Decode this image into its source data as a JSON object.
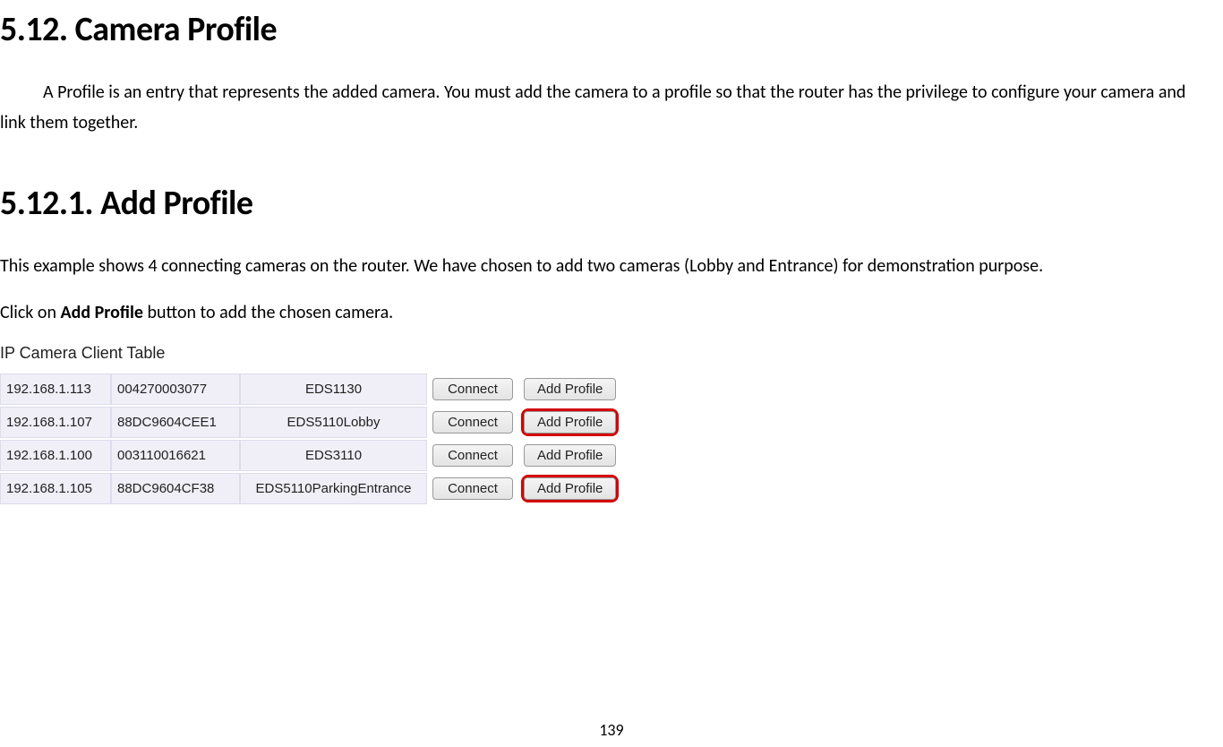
{
  "headings": {
    "section": "5.12.   Camera Profile",
    "subsection": "5.12.1. Add Profile"
  },
  "paragraphs": {
    "intro": "A Profile is an entry that represents the added camera. You must add the camera to a profile so that the router has the privilege to configure your camera and link them together.",
    "example": "This example shows 4 connecting cameras on the router. We have chosen to add two cameras (Lobby and Entrance) for demonstration purpose.",
    "click_pre": "Click on ",
    "click_bold": "Add Profile",
    "click_post": " button to add the chosen camera."
  },
  "table": {
    "title": "IP Camera Client Table",
    "connect_label": "Connect",
    "add_label": "Add Profile",
    "rows": [
      {
        "ip": "192.168.1.113",
        "mac": "004270003077",
        "name": "EDS1130",
        "highlight": false
      },
      {
        "ip": "192.168.1.107",
        "mac": "88DC9604CEE1",
        "name": "EDS5110Lobby",
        "highlight": true
      },
      {
        "ip": "192.168.1.100",
        "mac": "003110016621",
        "name": "EDS3110",
        "highlight": false
      },
      {
        "ip": "192.168.1.105",
        "mac": "88DC9604CF38",
        "name": "EDS5110ParkingEntrance",
        "highlight": true
      }
    ]
  },
  "page_number": "139"
}
